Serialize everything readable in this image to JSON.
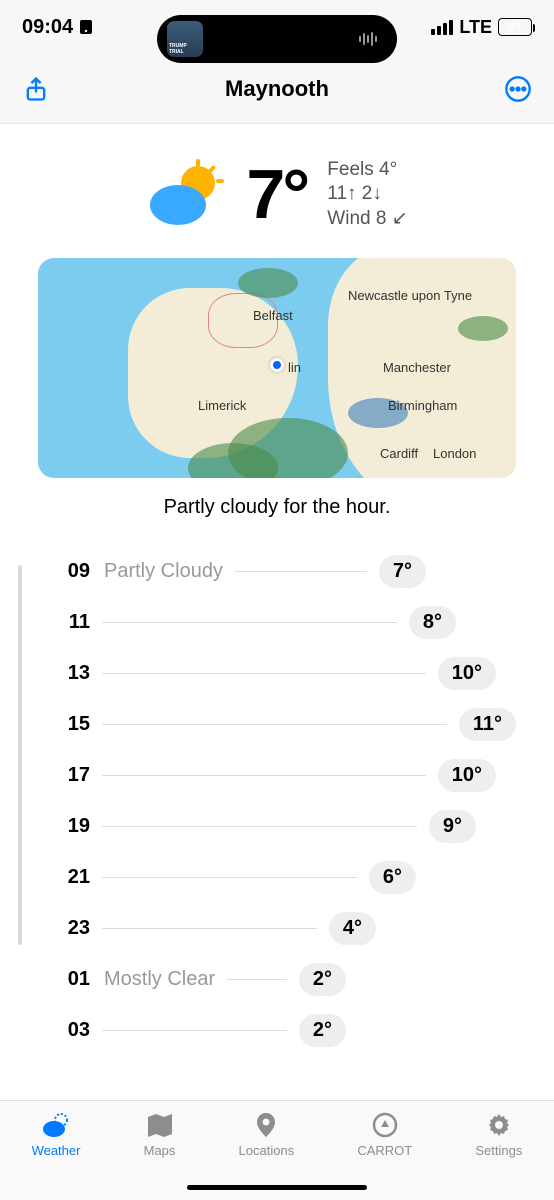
{
  "status": {
    "time": "09:04",
    "network": "LTE",
    "battery": "81"
  },
  "header": {
    "title": "Maynooth"
  },
  "current": {
    "temp": "7°",
    "feels": "Feels 4°",
    "hilo": "11↑ 2↓",
    "wind": "Wind 8 ↙"
  },
  "map": {
    "labels": {
      "newcastle": "Newcastle upon Tyne",
      "belfast": "Belfast",
      "dublin_suffix": "lin",
      "manchester": "Manchester",
      "limerick": "Limerick",
      "birmingham": "Birmingham",
      "cardiff": "Cardiff",
      "london": "London"
    }
  },
  "forecast_text": "Partly cloudy for the hour.",
  "hourly": [
    {
      "hour": "09",
      "cond": "Partly Cloudy",
      "temp": "7°",
      "pad": 320
    },
    {
      "hour": "11",
      "cond": "",
      "temp": "8°",
      "pad": 350
    },
    {
      "hour": "13",
      "cond": "",
      "temp": "10°",
      "pad": 390
    },
    {
      "hour": "15",
      "cond": "",
      "temp": "11°",
      "pad": 410
    },
    {
      "hour": "17",
      "cond": "",
      "temp": "10°",
      "pad": 390
    },
    {
      "hour": "19",
      "cond": "",
      "temp": "9°",
      "pad": 370
    },
    {
      "hour": "21",
      "cond": "",
      "temp": "6°",
      "pad": 310
    },
    {
      "hour": "23",
      "cond": "",
      "temp": "4°",
      "pad": 270
    },
    {
      "hour": "01",
      "cond": "Mostly Clear",
      "temp": "2°",
      "pad": 240
    },
    {
      "hour": "03",
      "cond": "",
      "temp": "2°",
      "pad": 240
    }
  ],
  "tabs": {
    "weather": "Weather",
    "maps": "Maps",
    "locations": "Locations",
    "carrot": "CARROT",
    "settings": "Settings"
  }
}
